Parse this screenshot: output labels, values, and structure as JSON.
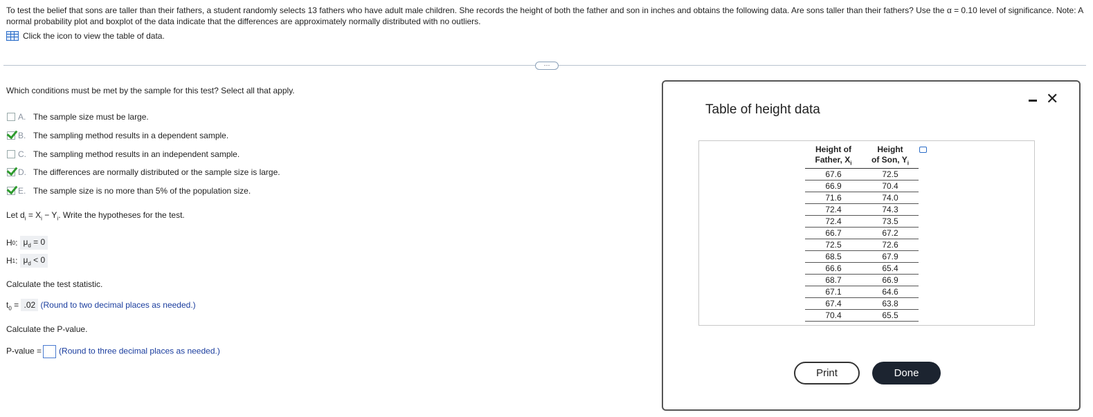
{
  "problem": {
    "text": "To test the belief that sons are taller than their fathers, a student randomly selects 13 fathers who have adult male children. She records the height of both the father and son in inches and obtains the following data. Are sons taller than their fathers? Use the α = 0.10 level of significance. Note: A normal probability plot and boxplot of the data indicate that the differences are approximately normally distributed with no outliers.",
    "icon_link": "Click the icon to view the table of data.",
    "table_icon": "table-grid-icon"
  },
  "handle_label": "⋯",
  "conditions": {
    "question": "Which conditions must be met by the sample for this test? Select all that apply.",
    "options": [
      {
        "letter": "A.",
        "text": "The sample size must be large.",
        "checked": false
      },
      {
        "letter": "B.",
        "text": "The sampling method results in a dependent sample.",
        "checked": true
      },
      {
        "letter": "C.",
        "text": "The sampling method results in an independent sample.",
        "checked": false
      },
      {
        "letter": "D.",
        "text": "The differences are normally distributed or the sample size is large.",
        "checked": true
      },
      {
        "letter": "E.",
        "text": "The sample size is no more than 5% of the population size.",
        "checked": true
      }
    ]
  },
  "hypotheses": {
    "intro_pre": "Let d",
    "intro_mid": " = X",
    "intro_mid2": " − Y",
    "intro_post": ". Write the hypotheses for the test.",
    "sub_i": "i",
    "h0_label": "H",
    "h0_sub": "0",
    "h0_value": "μ",
    "h0_value_sub": "d",
    "h0_rest": " = 0",
    "h1_label": "H",
    "h1_sub": "1",
    "h1_rest": " < 0"
  },
  "test_stat": {
    "prompt": "Calculate the test statistic.",
    "label": "t",
    "label_sub": "0",
    "eq": " = ",
    "value": ".02",
    "hint": "(Round to two decimal places as needed.)"
  },
  "pvalue": {
    "prompt": "Calculate the P-value.",
    "label": "P-value =",
    "value": "",
    "hint": "(Round to three decimal places as needed.)"
  },
  "dialog": {
    "title": "Table of height data",
    "col1_line1": "Height of",
    "col1_line2": "Father, X",
    "col2_line1": "Height",
    "col2_line2": "of Son, Y",
    "sub_i": "i",
    "rows": [
      [
        "67.6",
        "72.5"
      ],
      [
        "66.9",
        "70.4"
      ],
      [
        "71.6",
        "74.0"
      ],
      [
        "72.4",
        "74.3"
      ],
      [
        "72.4",
        "73.5"
      ],
      [
        "66.7",
        "67.2"
      ],
      [
        "72.5",
        "72.6"
      ],
      [
        "68.5",
        "67.9"
      ],
      [
        "66.6",
        "65.4"
      ],
      [
        "68.7",
        "66.9"
      ],
      [
        "67.1",
        "64.6"
      ],
      [
        "67.4",
        "63.8"
      ],
      [
        "70.4",
        "65.5"
      ]
    ],
    "print_label": "Print",
    "done_label": "Done",
    "close_glyph": "✕"
  }
}
